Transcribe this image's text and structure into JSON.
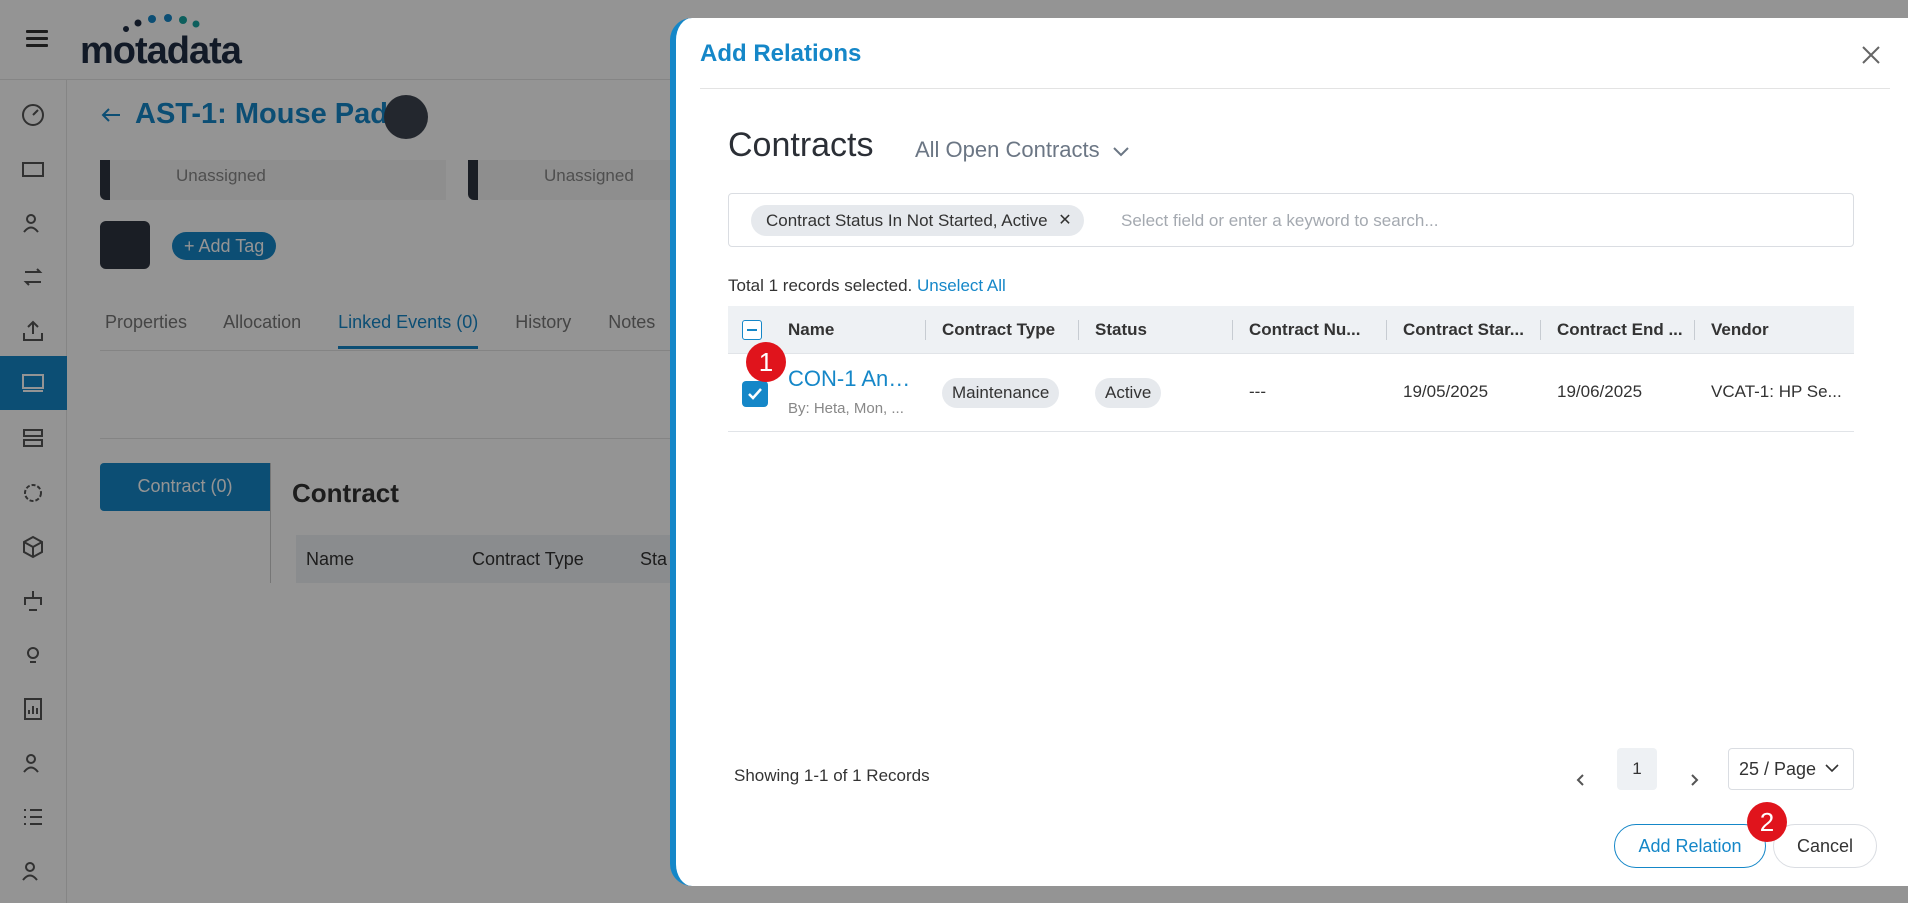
{
  "app": {
    "logo_text": "motadata",
    "page_title": "AST-1: Mouse Pad",
    "owner_cards": [
      "Unassigned",
      "Unassigned"
    ],
    "add_tag_label": "+ Add Tag",
    "tabs": [
      "Properties",
      "Allocation",
      "Linked Events (0)",
      "History",
      "Notes"
    ],
    "contract_pill": "Contract (0)",
    "contract_heading": "Contract",
    "bg_table_headers": [
      "Name",
      "Contract Type",
      "Sta"
    ]
  },
  "drawer": {
    "title": "Add Relations",
    "section_title": "Contracts",
    "filter_view": "All Open Contracts",
    "search": {
      "chip": "Contract Status In Not Started, Active",
      "placeholder": "Select field or enter a keyword to search..."
    },
    "selection": {
      "text": "Total 1 records selected.",
      "unselect_label": "Unselect All"
    },
    "table": {
      "headers": [
        "Name",
        "Contract Type",
        "Status",
        "Contract Nu...",
        "Contract Star...",
        "Contract End ...",
        "Vendor"
      ],
      "rows": [
        {
          "name": "CON-1 Ann...",
          "by": "By: Heta, Mon, ...",
          "contract_type": "Maintenance",
          "status": "Active",
          "contract_number": "---",
          "start_date": "19/05/2025",
          "end_date": "19/06/2025",
          "vendor": "VCAT-1: HP Se..."
        }
      ]
    },
    "pagination": {
      "info": "Showing 1-1 of 1 Records",
      "current_page": "1",
      "per_page": "25 / Page"
    },
    "buttons": {
      "add_relation": "Add Relation",
      "cancel": "Cancel"
    },
    "badges": [
      "1",
      "2"
    ]
  },
  "colors": {
    "accent": "#1587c8",
    "badge": "#e0141c",
    "overlay": "rgba(0,0,0,0.42)"
  }
}
